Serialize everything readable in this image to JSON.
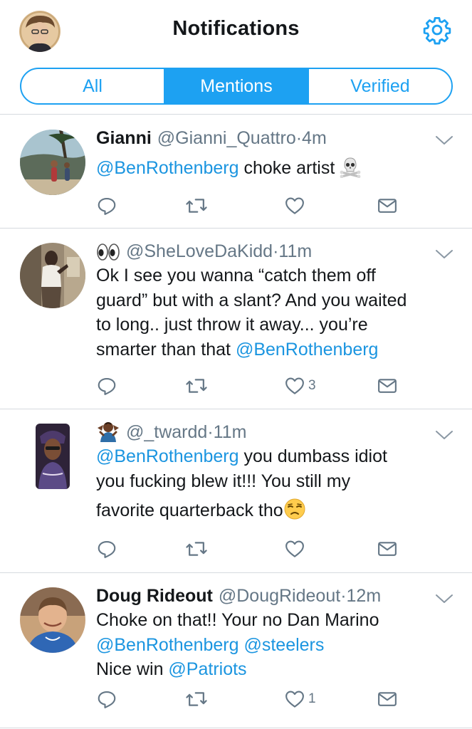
{
  "header": {
    "title": "Notifications",
    "avatar_icon": "profile-avatar",
    "settings_icon": "gear-icon"
  },
  "tabs": [
    {
      "label": "All",
      "active": false
    },
    {
      "label": "Mentions",
      "active": true
    },
    {
      "label": "Verified",
      "active": false
    }
  ],
  "colors": {
    "accent": "#1da1f2",
    "mention": "#1b95e0",
    "meta": "#657786",
    "divider": "#d6dadf"
  },
  "tweets": [
    {
      "name": "Gianni",
      "handle": "@Gianni_Quattro",
      "time": "4m",
      "parts": [
        {
          "text": "@BenRothenberg",
          "mention": true
        },
        {
          "text": " choke artist ",
          "mention": false
        },
        {
          "emoji": "skull-crossbones-emoji"
        }
      ],
      "replies": "",
      "retweets": "",
      "likes": ""
    },
    {
      "name": "",
      "name_emoji": "eyes-emoji",
      "handle": "@SheLoveDaKidd",
      "time": "11m",
      "lines": [
        [
          {
            "text": "Ok I see you wanna “catch them off"
          }
        ],
        [
          {
            "text": "guard” but with a slant? And you waited"
          }
        ],
        [
          {
            "text": "to long.. just throw it away... you’re"
          }
        ],
        [
          {
            "text": "smarter than that "
          },
          {
            "text": "@BenRothenberg",
            "mention": true
          }
        ]
      ],
      "replies": "",
      "retweets": "",
      "likes": "3"
    },
    {
      "name": "",
      "name_emoji": "person-shrugging-emoji",
      "handle": "@_twardd",
      "time": "11m",
      "lines": [
        [
          {
            "text": "@BenRothenberg",
            "mention": true
          },
          {
            "text": " you dumbass idiot"
          }
        ],
        [
          {
            "text": "you fucking blew it!!! You still my"
          }
        ],
        [
          {
            "text": "favorite quarterback tho"
          },
          {
            "emoji": "unamused-face-emoji"
          }
        ]
      ],
      "replies": "",
      "retweets": "",
      "likes": ""
    },
    {
      "name": "Doug Rideout",
      "handle": "@DougRideout",
      "time": "12m",
      "lines": [
        [
          {
            "text": "Choke on that!! Your no Dan Marino"
          }
        ],
        [
          {
            "text": "@BenRothenberg",
            "mention": true
          },
          {
            "text": " "
          },
          {
            "text": "@steelers",
            "mention": true
          }
        ],
        [
          {
            "text": "Nice win "
          },
          {
            "text": "@Patriots",
            "mention": true
          }
        ]
      ],
      "replies": "",
      "retweets": "",
      "likes": "1"
    }
  ]
}
